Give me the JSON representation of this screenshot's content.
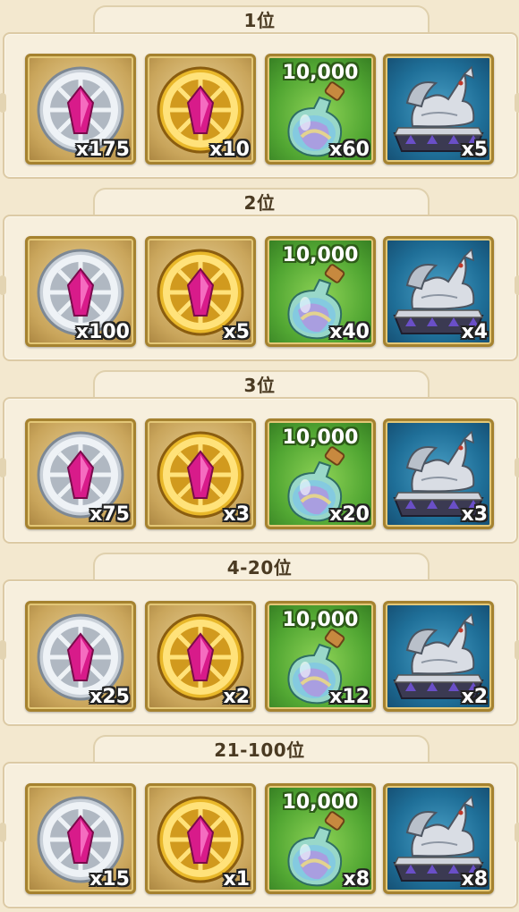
{
  "icons": {
    "silver_medal": "silver-gem-medal-icon",
    "gold_medal": "gold-gem-medal-icon",
    "potion": "potion-flask-icon",
    "dragon_chest": "dragon-chest-icon"
  },
  "colors": {
    "background": "#f3e8cf",
    "panel": "#f7efdd",
    "frame_gold": "#a5822f",
    "tile_gold": "#c9a55b",
    "tile_green": "#52a733",
    "tile_blue": "#1f6f98",
    "gem_pink": "#d81b8a"
  },
  "ranks": [
    {
      "title": "1位",
      "rewards": [
        {
          "icon": "silver-gem-medal-icon",
          "qty": "x175"
        },
        {
          "icon": "gold-gem-medal-icon",
          "qty": "x10"
        },
        {
          "icon": "potion-flask-icon",
          "amount": "10,000",
          "qty": "x60"
        },
        {
          "icon": "dragon-chest-icon",
          "qty": "x5"
        }
      ]
    },
    {
      "title": "2位",
      "rewards": [
        {
          "icon": "silver-gem-medal-icon",
          "qty": "x100"
        },
        {
          "icon": "gold-gem-medal-icon",
          "qty": "x5"
        },
        {
          "icon": "potion-flask-icon",
          "amount": "10,000",
          "qty": "x40"
        },
        {
          "icon": "dragon-chest-icon",
          "qty": "x4"
        }
      ]
    },
    {
      "title": "3位",
      "rewards": [
        {
          "icon": "silver-gem-medal-icon",
          "qty": "x75"
        },
        {
          "icon": "gold-gem-medal-icon",
          "qty": "x3"
        },
        {
          "icon": "potion-flask-icon",
          "amount": "10,000",
          "qty": "x20"
        },
        {
          "icon": "dragon-chest-icon",
          "qty": "x3"
        }
      ]
    },
    {
      "title": "4-20位",
      "rewards": [
        {
          "icon": "silver-gem-medal-icon",
          "qty": "x25"
        },
        {
          "icon": "gold-gem-medal-icon",
          "qty": "x2"
        },
        {
          "icon": "potion-flask-icon",
          "amount": "10,000",
          "qty": "x12"
        },
        {
          "icon": "dragon-chest-icon",
          "qty": "x2"
        }
      ]
    },
    {
      "title": "21-100位",
      "rewards": [
        {
          "icon": "silver-gem-medal-icon",
          "qty": "x15"
        },
        {
          "icon": "gold-gem-medal-icon",
          "qty": "x1"
        },
        {
          "icon": "potion-flask-icon",
          "amount": "10,000",
          "qty": "x8"
        },
        {
          "icon": "dragon-chest-icon",
          "qty": "x8"
        }
      ]
    }
  ]
}
